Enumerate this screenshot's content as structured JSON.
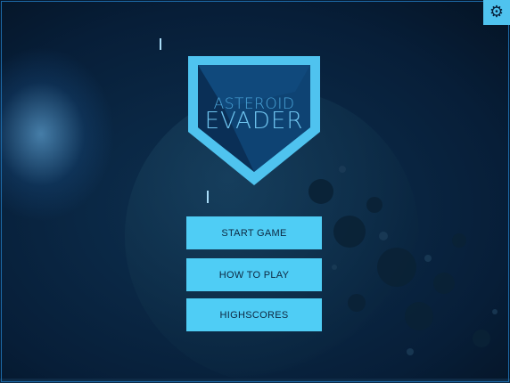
{
  "game": {
    "title_line1": "ASTEROID",
    "title_line2": "EVADER"
  },
  "settings": {
    "icon": "gear-icon",
    "glyph": "⚙"
  },
  "menu": {
    "buttons": [
      {
        "label": "START GAME"
      },
      {
        "label": "HOW TO PLAY"
      },
      {
        "label": "HIGHSCORES"
      }
    ]
  },
  "colors": {
    "accent": "#4fcdf5",
    "background": "#061a30",
    "shield_outer": "#4fc3ef",
    "shield_inner": "#0d3a66"
  }
}
